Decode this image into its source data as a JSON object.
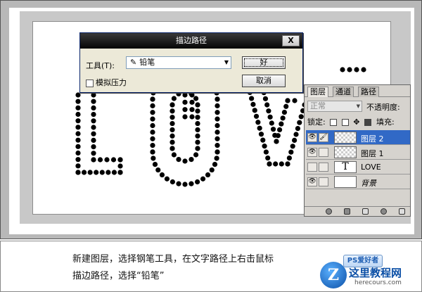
{
  "dialog": {
    "title": "描边路径",
    "close_label": "X",
    "tool_label": "工具(T):",
    "tool_icon": "pencil-icon",
    "tool_value": "铅笔",
    "simulate_pressure_label": "模拟压力",
    "simulate_pressure_checked": false,
    "ok_label": "好",
    "cancel_label": "取消"
  },
  "layers_panel": {
    "tabs": [
      "图层",
      "通道",
      "路径"
    ],
    "active_tab": "图层",
    "blend_mode": "正常",
    "opacity_label": "不透明度:",
    "lock_label": "锁定:",
    "fill_label": "填充:",
    "layers": [
      {
        "name": "图层 2",
        "selected": true,
        "visible": true,
        "thumb": "transparent"
      },
      {
        "name": "图层 1",
        "selected": false,
        "visible": true,
        "thumb": "beads"
      },
      {
        "name": "LOVE",
        "selected": false,
        "visible": false,
        "thumb": "text"
      },
      {
        "name": "背景",
        "selected": false,
        "visible": true,
        "thumb": "white"
      }
    ]
  },
  "caption": {
    "line1": "新建图层，选择钢笔工具，在文字路径上右击鼠标",
    "line2": "描边路径，选择“铅笔”"
  },
  "watermark": {
    "badge": "PS爱好者",
    "logo_letter": "Z",
    "site_title": "这里教程网",
    "site_url": "herecours.com"
  },
  "colors": {
    "selected_layer": "#3169c6",
    "dialog_title_bar": "#0a0a0a",
    "bead": "#000000"
  }
}
